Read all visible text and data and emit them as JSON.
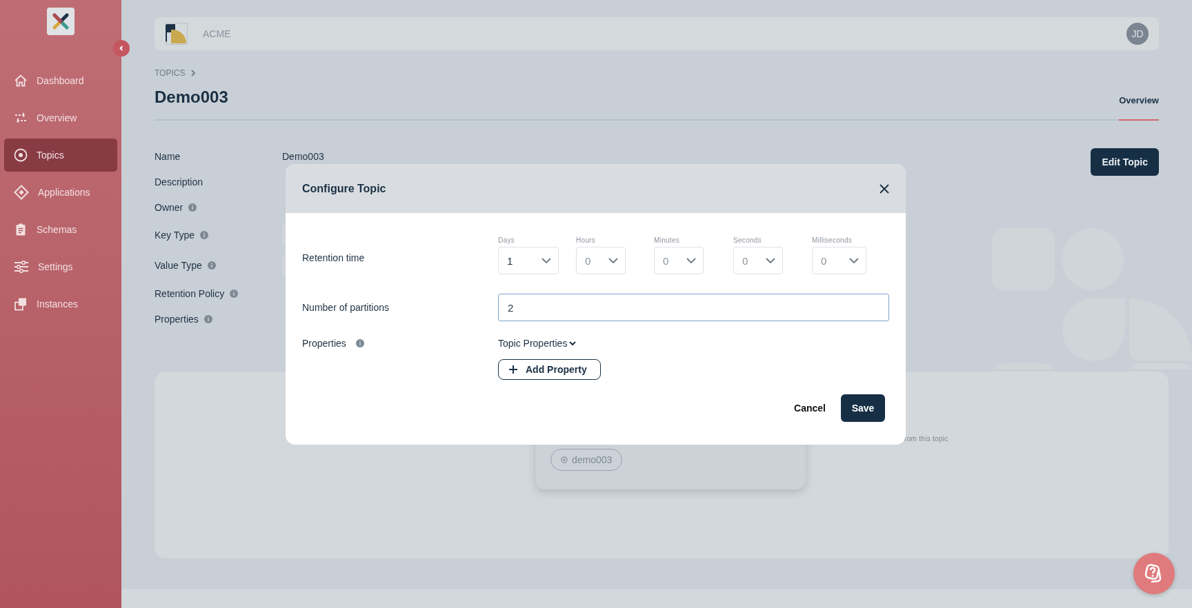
{
  "sidebar": {
    "items": [
      {
        "label": "Dashboard",
        "selected": false
      },
      {
        "label": "Overview",
        "selected": false
      },
      {
        "label": "Topics",
        "selected": true
      },
      {
        "label": "Applications",
        "selected": false
      },
      {
        "label": "Schemas",
        "selected": false
      },
      {
        "label": "Settings",
        "selected": false
      },
      {
        "label": "Instances",
        "selected": false
      }
    ]
  },
  "header": {
    "org": "ACME",
    "avatar": "JD"
  },
  "breadcrumb": "TOPICS",
  "title": "Demo003",
  "tabs": [
    {
      "label": "Overview",
      "selected": true
    }
  ],
  "details": [
    {
      "label": "Name",
      "info": false,
      "kind": "text",
      "value": "Demo003"
    },
    {
      "label": "Description",
      "info": false,
      "kind": "covered"
    },
    {
      "label": "Owner",
      "info": true,
      "kind": "covered"
    },
    {
      "label": "Key Type",
      "info": true,
      "kind": "box"
    },
    {
      "label": "Value Type",
      "info": true,
      "kind": "box"
    },
    {
      "label": "Retention Policy",
      "info": true,
      "kind": "covered"
    },
    {
      "label": "Properties",
      "info": true,
      "kind": "covered"
    }
  ],
  "edit_button": "Edit Topic",
  "consumers": {
    "chips": [
      "demo003"
    ],
    "note": "rom this topic"
  },
  "modal": {
    "title": "Configure Topic",
    "retention": {
      "label": "Retention time",
      "units": [
        {
          "label": "Days",
          "value": "1"
        },
        {
          "label": "Hours",
          "placeholder": "0"
        },
        {
          "label": "Minutes",
          "placeholder": "0"
        },
        {
          "label": "Seconds",
          "placeholder": "0"
        },
        {
          "label": "Milliseconds",
          "placeholder": "0"
        }
      ]
    },
    "partitions": {
      "label": "Number of partitions",
      "value": "2",
      "focused": true
    },
    "properties": {
      "label": "Properties",
      "info": true,
      "dropdown": "Topic Properties",
      "add_button": "Add Property"
    },
    "buttons": {
      "cancel": "Cancel",
      "save": "Save"
    }
  }
}
